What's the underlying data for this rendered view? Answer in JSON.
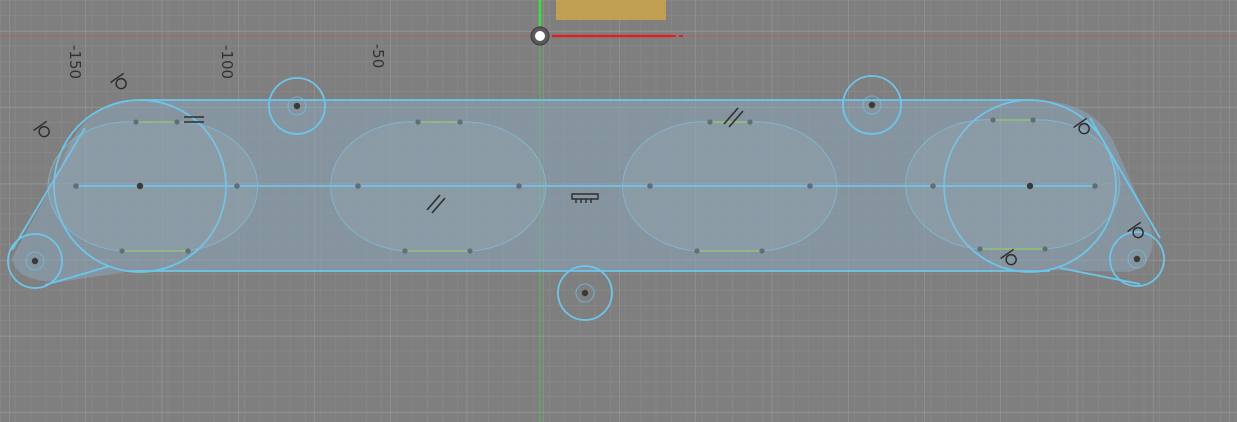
{
  "ruler": {
    "ticks": [
      "-150",
      "-100",
      "-50"
    ]
  },
  "colors": {
    "background": "#7f7f7f",
    "grid_minor": "#898989",
    "grid_major": "#9a9a9a",
    "axis_x": "#d43b3b",
    "axis_y": "#3fc43f",
    "sketch_line": "#6cc6ec",
    "sketch_fill": "#8aa5b8",
    "sketch_point": "#3a3a3a",
    "constraint_line": "#9bd15a",
    "face_highlight": "#c8a24e"
  },
  "icons": [
    "origin-point-icon",
    "tangent-constraint-icon",
    "parallel-constraint-icon",
    "horizontal-constraint-icon",
    "fix-constraint-icon"
  ]
}
